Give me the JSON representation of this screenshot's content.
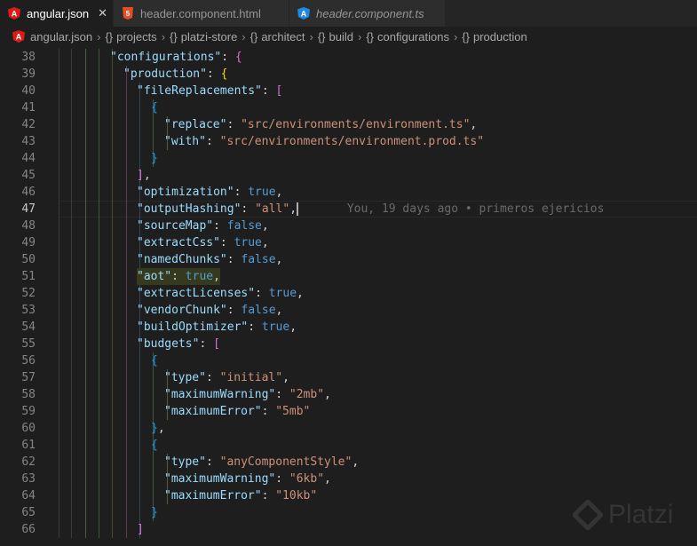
{
  "tabs": [
    {
      "label": "angular.json",
      "active": true,
      "icon": "angular-icon",
      "close": "✕"
    },
    {
      "label": "header.component.html",
      "active": false,
      "icon": "html5-icon"
    },
    {
      "label": "header.component.ts",
      "active": false,
      "icon": "angular-ts-icon",
      "italic": true
    }
  ],
  "breadcrumb": {
    "file": "angular.json",
    "items": [
      "projects",
      "platzi-store",
      "architect",
      "build",
      "configurations",
      "production"
    ],
    "brace": "{}"
  },
  "editor": {
    "current_line": 47,
    "blame": "You, 19 days ago • primeros ejericios",
    "line_numbers": [
      "38",
      "39",
      "40",
      "41",
      "42",
      "43",
      "44",
      "45",
      "46",
      "47",
      "48",
      "49",
      "50",
      "51",
      "52",
      "53",
      "54",
      "55",
      "56",
      "57",
      "58",
      "59",
      "60",
      "61",
      "62",
      "63",
      "64",
      "65",
      "66"
    ],
    "lines": [
      [
        [
          "\"configurations\"",
          "k"
        ],
        [
          ": ",
          "p"
        ],
        [
          "{",
          "m"
        ]
      ],
      [
        [
          "\"production\"",
          "k"
        ],
        [
          ": ",
          "p"
        ],
        [
          "{",
          "y"
        ]
      ],
      [
        [
          "\"fileReplacements\"",
          "k"
        ],
        [
          ": ",
          "p"
        ],
        [
          "[",
          "m"
        ]
      ],
      [
        [
          "{",
          "c"
        ]
      ],
      [
        [
          "\"replace\"",
          "k"
        ],
        [
          ": ",
          "p"
        ],
        [
          "\"src/environments/environment.ts\"",
          "s"
        ],
        [
          ",",
          "p"
        ]
      ],
      [
        [
          "\"with\"",
          "k"
        ],
        [
          ": ",
          "p"
        ],
        [
          "\"src/environments/environment.prod.ts\"",
          "s"
        ]
      ],
      [
        [
          "}",
          "c"
        ]
      ],
      [
        [
          "]",
          "m"
        ],
        [
          ",",
          "p"
        ]
      ],
      [
        [
          "\"optimization\"",
          "k"
        ],
        [
          ": ",
          "p"
        ],
        [
          "true",
          "b"
        ],
        [
          ",",
          "p"
        ]
      ],
      [
        [
          "\"outputHashing\"",
          "k"
        ],
        [
          ": ",
          "p"
        ],
        [
          "\"all\"",
          "s"
        ],
        [
          ",",
          "p"
        ]
      ],
      [
        [
          "\"sourceMap\"",
          "k"
        ],
        [
          ": ",
          "p"
        ],
        [
          "false",
          "b"
        ],
        [
          ",",
          "p"
        ]
      ],
      [
        [
          "\"extractCss\"",
          "k"
        ],
        [
          ": ",
          "p"
        ],
        [
          "true",
          "b"
        ],
        [
          ",",
          "p"
        ]
      ],
      [
        [
          "\"namedChunks\"",
          "k"
        ],
        [
          ": ",
          "p"
        ],
        [
          "false",
          "b"
        ],
        [
          ",",
          "p"
        ]
      ],
      [
        [
          "\"aot\"",
          "k"
        ],
        [
          ": ",
          "p"
        ],
        [
          "true",
          "b"
        ],
        [
          ",",
          "p"
        ]
      ],
      [
        [
          "\"extractLicenses\"",
          "k"
        ],
        [
          ": ",
          "p"
        ],
        [
          "true",
          "b"
        ],
        [
          ",",
          "p"
        ]
      ],
      [
        [
          "\"vendorChunk\"",
          "k"
        ],
        [
          ": ",
          "p"
        ],
        [
          "false",
          "b"
        ],
        [
          ",",
          "p"
        ]
      ],
      [
        [
          "\"buildOptimizer\"",
          "k"
        ],
        [
          ": ",
          "p"
        ],
        [
          "true",
          "b"
        ],
        [
          ",",
          "p"
        ]
      ],
      [
        [
          "\"budgets\"",
          "k"
        ],
        [
          ": ",
          "p"
        ],
        [
          "[",
          "m"
        ]
      ],
      [
        [
          "{",
          "c"
        ]
      ],
      [
        [
          "\"type\"",
          "k"
        ],
        [
          ": ",
          "p"
        ],
        [
          "\"initial\"",
          "s"
        ],
        [
          ",",
          "p"
        ]
      ],
      [
        [
          "\"maximumWarning\"",
          "k"
        ],
        [
          ": ",
          "p"
        ],
        [
          "\"2mb\"",
          "s"
        ],
        [
          ",",
          "p"
        ]
      ],
      [
        [
          "\"maximumError\"",
          "k"
        ],
        [
          ": ",
          "p"
        ],
        [
          "\"5mb\"",
          "s"
        ]
      ],
      [
        [
          "}",
          "c"
        ],
        [
          ",",
          "p"
        ]
      ],
      [
        [
          "{",
          "c"
        ]
      ],
      [
        [
          "\"type\"",
          "k"
        ],
        [
          ": ",
          "p"
        ],
        [
          "\"anyComponentStyle\"",
          "s"
        ],
        [
          ",",
          "p"
        ]
      ],
      [
        [
          "\"maximumWarning\"",
          "k"
        ],
        [
          ": ",
          "p"
        ],
        [
          "\"6kb\"",
          "s"
        ],
        [
          ",",
          "p"
        ]
      ],
      [
        [
          "\"maximumError\"",
          "k"
        ],
        [
          ": ",
          "p"
        ],
        [
          "\"10kb\"",
          "s"
        ]
      ],
      [
        [
          "}",
          "c"
        ]
      ],
      [
        [
          "]",
          "m"
        ]
      ]
    ],
    "indent_levels": [
      5,
      6,
      7,
      8,
      9,
      9,
      8,
      7,
      7,
      7,
      7,
      7,
      7,
      7,
      7,
      7,
      7,
      7,
      8,
      9,
      9,
      9,
      8,
      8,
      9,
      9,
      9,
      8,
      7
    ]
  },
  "watermark": {
    "text": "Platzi",
    "icon": "platzi-logo-icon"
  },
  "colors": {
    "bg": "#1e1e1e",
    "tabbar": "#252526",
    "key": "#9cdcfe",
    "string": "#ce9178",
    "bool": "#569cd6",
    "brace_gold": "#ffd700",
    "brace_pink": "#da70d6",
    "brace_blue": "#179fff"
  }
}
